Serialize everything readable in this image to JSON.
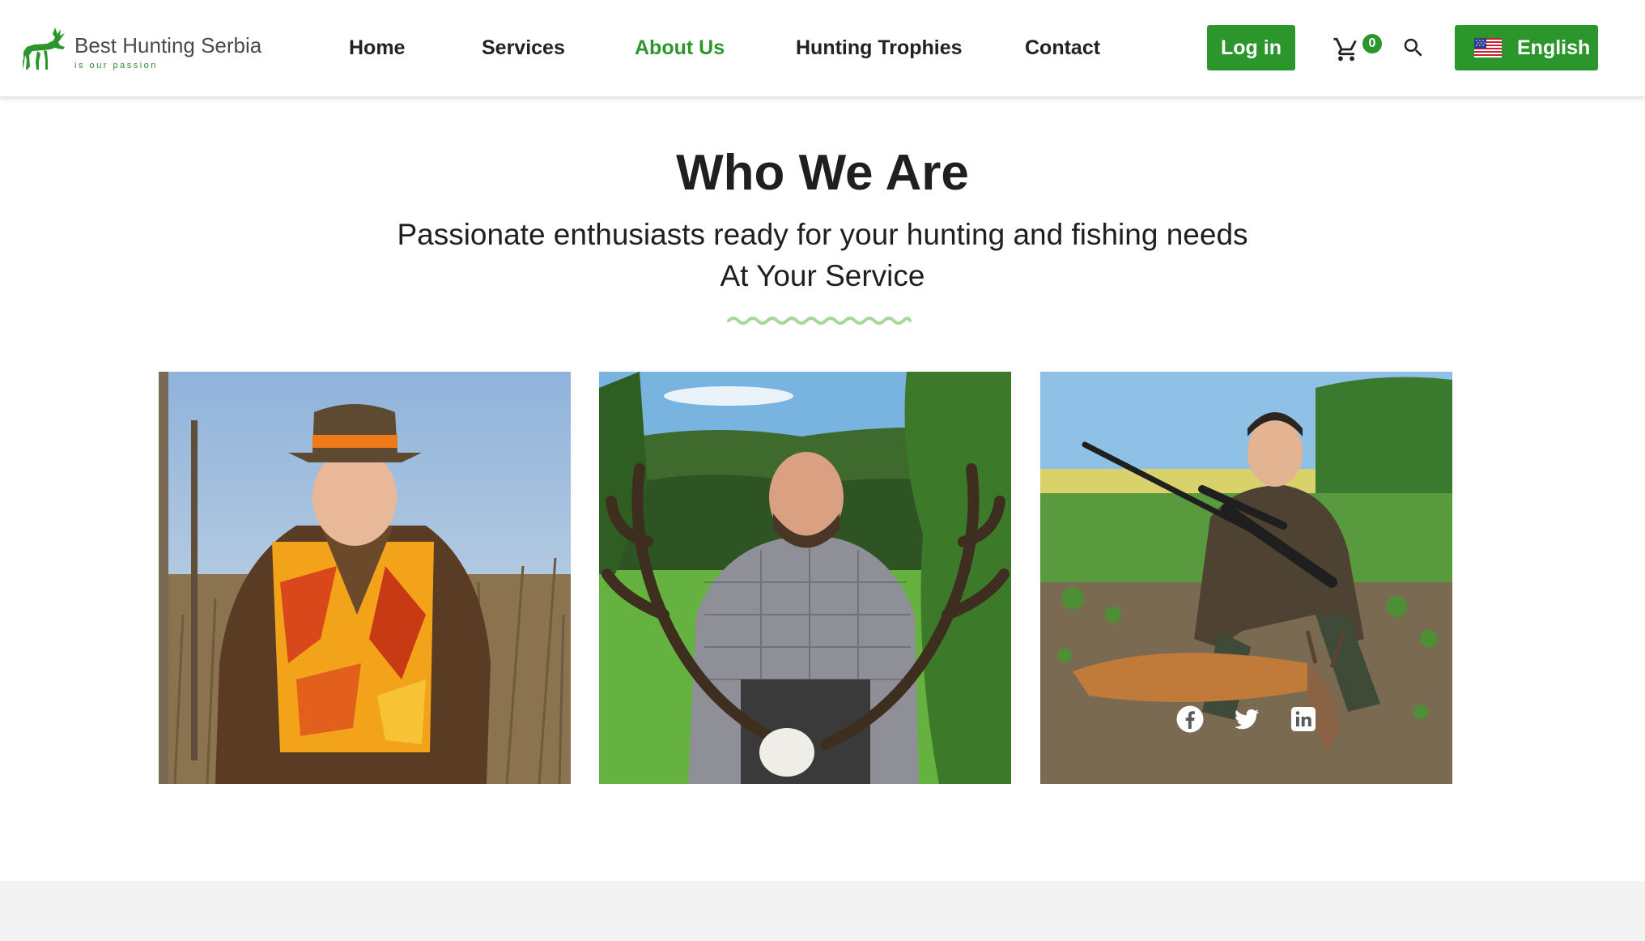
{
  "brand": {
    "name": "Best Hunting Serbia",
    "tagline": "is our passion",
    "color": "#2b962b"
  },
  "nav": {
    "items": [
      {
        "label": "Home",
        "active": false
      },
      {
        "label": "Services",
        "active": false
      },
      {
        "label": "About Us",
        "active": true
      },
      {
        "label": "Hunting Trophies",
        "active": false
      },
      {
        "label": "Contact",
        "active": false
      }
    ]
  },
  "header": {
    "login_label": "Log in",
    "cart_icon": "cart-icon",
    "cart_count": "0",
    "search_icon": "search-icon",
    "language": {
      "flag_icon": "us-flag-icon",
      "label": "English"
    }
  },
  "hero": {
    "title": "Who We Are",
    "subtitle_line1": "Passionate enthusiasts ready for your hunting and fishing needs",
    "subtitle_line2": "At Your Service",
    "divider_icon": "wave-divider"
  },
  "team": [
    {
      "photo_icon": "hunter-orange-vest-photo",
      "social": []
    },
    {
      "photo_icon": "hunter-red-deer-antlers-photo",
      "social": []
    },
    {
      "photo_icon": "hunter-rifle-roe-deer-photo",
      "social": [
        "facebook-icon",
        "twitter-icon",
        "linkedin-icon"
      ]
    }
  ],
  "colors": {
    "accent": "#2b962b",
    "text": "#1f1f1f",
    "footer_bg": "#f3f3f3"
  }
}
